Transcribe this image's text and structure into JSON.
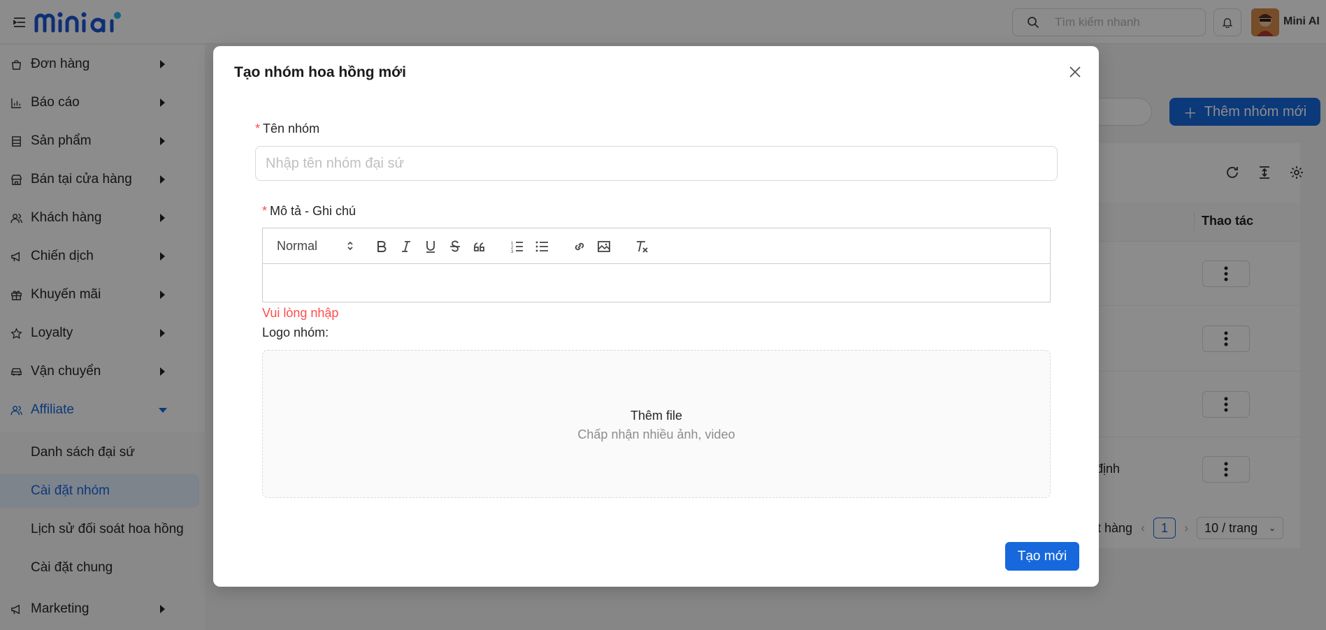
{
  "header": {
    "brand": "mini ai",
    "search_placeholder": "Tìm kiếm nhanh",
    "user_name": "Mini AI"
  },
  "sidebar": {
    "items": [
      {
        "label": "Đơn hàng",
        "icon": "bag-icon"
      },
      {
        "label": "Báo cáo",
        "icon": "chart-icon"
      },
      {
        "label": "Sản phẩm",
        "icon": "box-icon"
      },
      {
        "label": "Bán tại cửa hàng",
        "icon": "store-icon"
      },
      {
        "label": "Khách hàng",
        "icon": "users-icon"
      },
      {
        "label": "Chiến dịch",
        "icon": "megaphone-icon"
      },
      {
        "label": "Khuyến mãi",
        "icon": "gift-icon"
      },
      {
        "label": "Loyalty",
        "icon": "star-icon"
      },
      {
        "label": "Vận chuyển",
        "icon": "car-icon"
      },
      {
        "label": "Affiliate",
        "icon": "users-icon"
      }
    ],
    "affiliate_sub": [
      {
        "label": "Danh sách đại sứ"
      },
      {
        "label": "Cài đặt nhóm"
      },
      {
        "label": "Lịch sử đối soát hoa hồng"
      },
      {
        "label": "Cài đặt chung"
      }
    ],
    "bottom_item": {
      "label": "Marketing",
      "icon": "megaphone-icon"
    }
  },
  "background": {
    "add_group_label": "Thêm nhóm mới",
    "actions_header": "Thao tác",
    "row_fragment": "định",
    "pager_fragment": "ặt hàng",
    "current_page": "1",
    "page_size": "10 / trang"
  },
  "modal": {
    "title": "Tạo nhóm hoa hồng mới",
    "name_label": "Tên nhóm",
    "name_placeholder": "Nhập tên nhóm đại sứ",
    "desc_label": "Mô tả - Ghi chú",
    "editor_format": "Normal",
    "error_text": "Vui lòng nhập",
    "logo_label": "Logo nhóm:",
    "upload_title": "Thêm file",
    "upload_hint": "Chấp nhận nhiều ảnh, video",
    "submit_label": "Tạo mới"
  },
  "colors": {
    "primary": "#1668dc",
    "error": "#ff4d4f",
    "overlay": "rgba(0,0,0,0.45)"
  }
}
